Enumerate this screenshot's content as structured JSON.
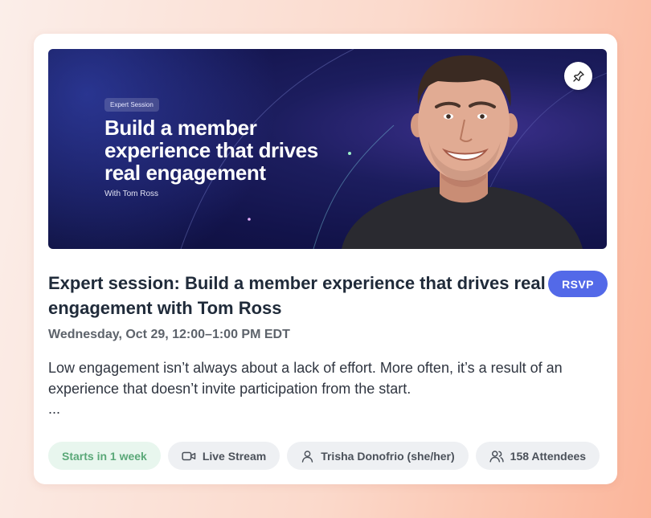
{
  "banner": {
    "pill": "Expert Session",
    "title": "Build a member experience that drives real engagement",
    "with": "With Tom Ross",
    "pin_icon": "pin-icon"
  },
  "event": {
    "title": "Expert session: Build a member experience that drives real engagement with Tom Ross",
    "rsvp_label": "RSVP",
    "date": "Wednesday, Oct 29, 12:00–1:00 PM EDT",
    "description": "Low engagement isn’t always about a lack of effort. More often, it’s a result of an experience that doesn’t invite participation from the start.",
    "ellipsis": "..."
  },
  "chips": {
    "starts": "Starts in 1 week",
    "stream": "Live Stream",
    "host": "Trisha Donofrio (she/her)",
    "attendees": "158 Attendees"
  },
  "colors": {
    "accent": "#5369e8",
    "green_text": "#5aa878",
    "green_bg": "#e8f6ee",
    "banner_bg": "#12134a"
  }
}
